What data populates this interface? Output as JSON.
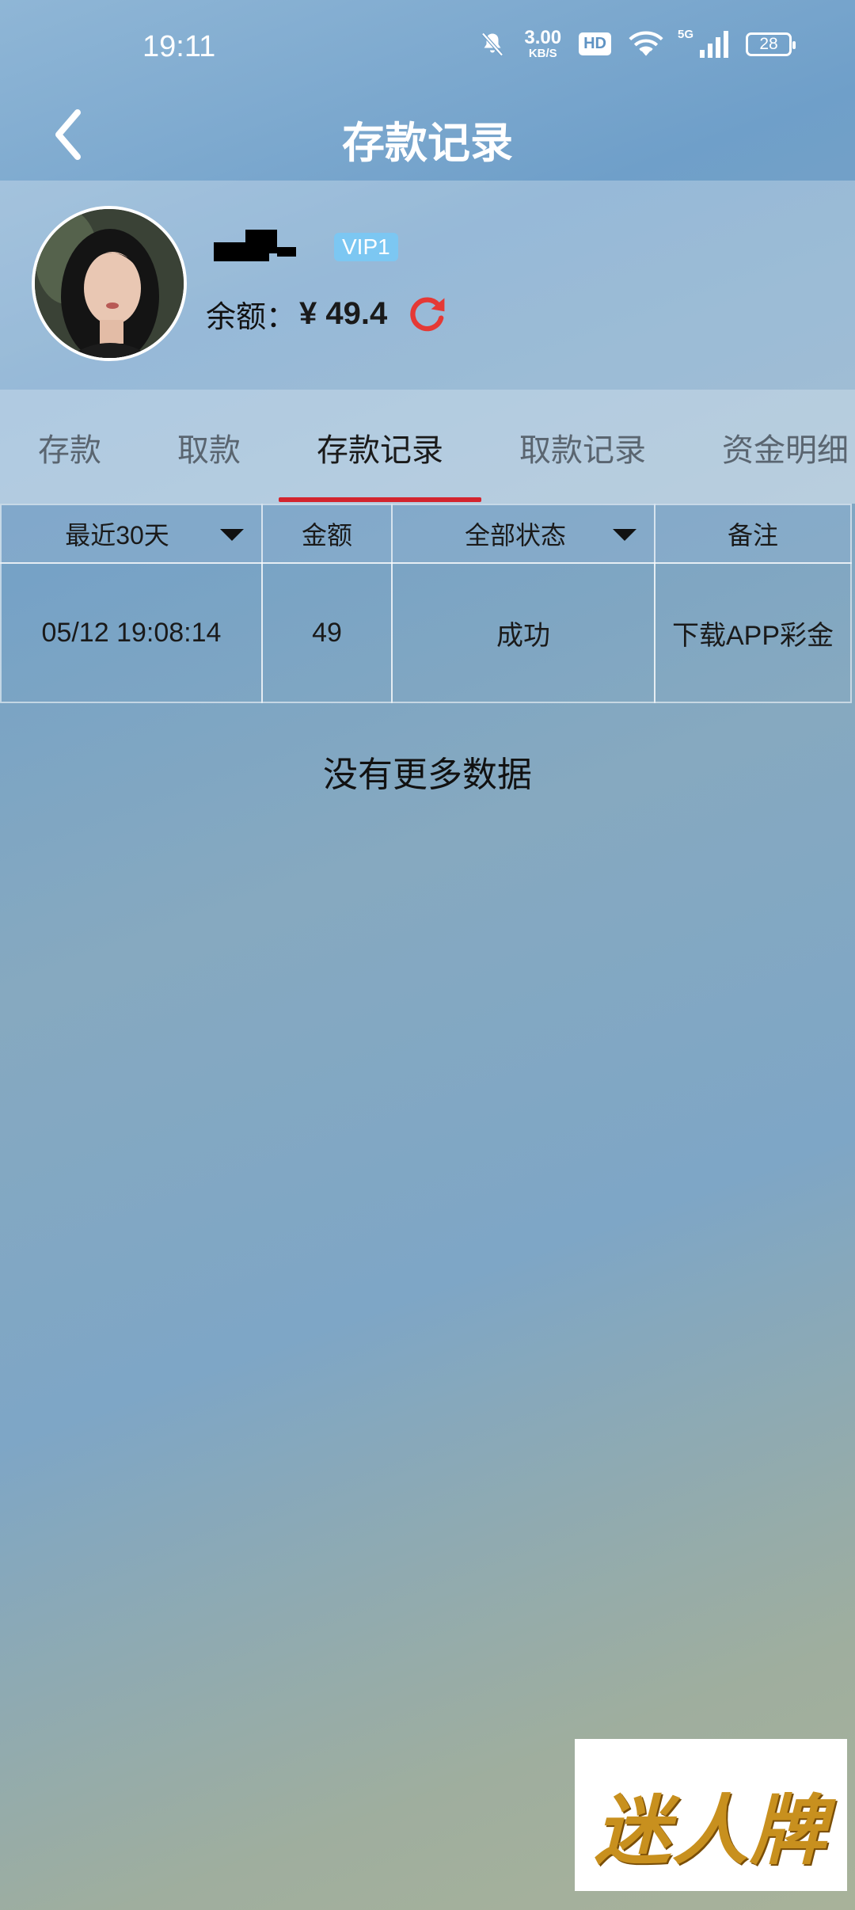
{
  "status_bar": {
    "time": "19:11",
    "net_speed_value": "3.00",
    "net_speed_unit": "KB/S",
    "hd_label": "HD",
    "signal_label": "5G",
    "battery": "28"
  },
  "header": {
    "title": "存款记录"
  },
  "profile": {
    "vip": "VIP1",
    "balance_label": "余额：",
    "balance_value": "¥ 49.4"
  },
  "tabs": [
    {
      "label": "存款"
    },
    {
      "label": "取款"
    },
    {
      "label": "存款记录"
    },
    {
      "label": "取款记录"
    },
    {
      "label": "资金明细"
    }
  ],
  "active_tab": "存款记录",
  "table": {
    "headers": [
      "最近30天",
      "金额",
      "全部状态",
      "备注"
    ],
    "rows": [
      [
        "05/12 19:08:14",
        "49",
        "成功",
        "下载APP彩金"
      ]
    ]
  },
  "footer_text": "没有更多数据",
  "logo_text": "迷人牌",
  "colors": {
    "accent": "#d3242e",
    "vip_badge": "#7cc7f2",
    "refresh": "#e53935",
    "title": "#ffffff"
  }
}
